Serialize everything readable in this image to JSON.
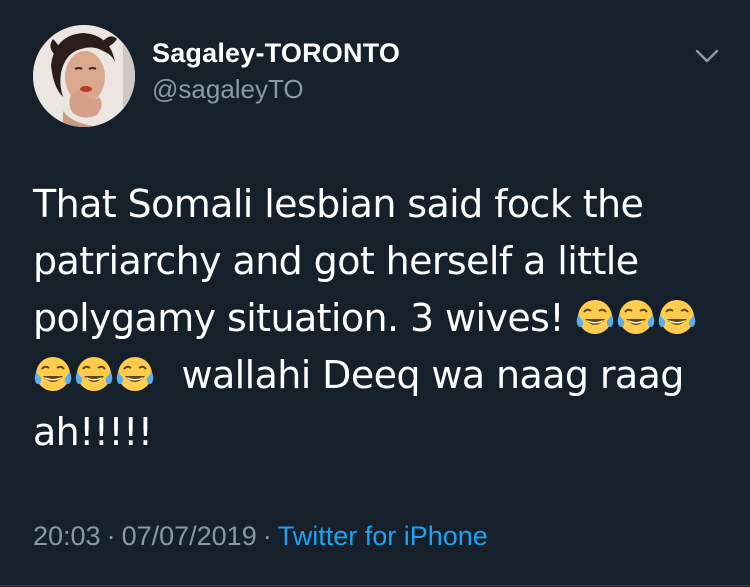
{
  "colors": {
    "background": "#15202b",
    "text_primary": "#ffffff",
    "text_secondary": "#8899a6",
    "link": "#1da1f2"
  },
  "author": {
    "display_name": "Sagaley-TORONTO",
    "handle": "@sagaleyTO",
    "avatar_icon": "profile-photo"
  },
  "tweet": {
    "line1": "That Somali lesbian said fock the",
    "line2": "patriarchy and got herself a little",
    "line3": "polygamy situation. 3 wives!",
    "line4_text": "wallahi Deeq wa naag raag",
    "line5": "ah!!!!!",
    "emoji_name": "face-with-tears-of-joy-emoji"
  },
  "meta": {
    "time": "20:03",
    "date": "07/07/2019",
    "separator": "·",
    "source": "Twitter for iPhone"
  },
  "menu_icon": "chevron-down-icon"
}
